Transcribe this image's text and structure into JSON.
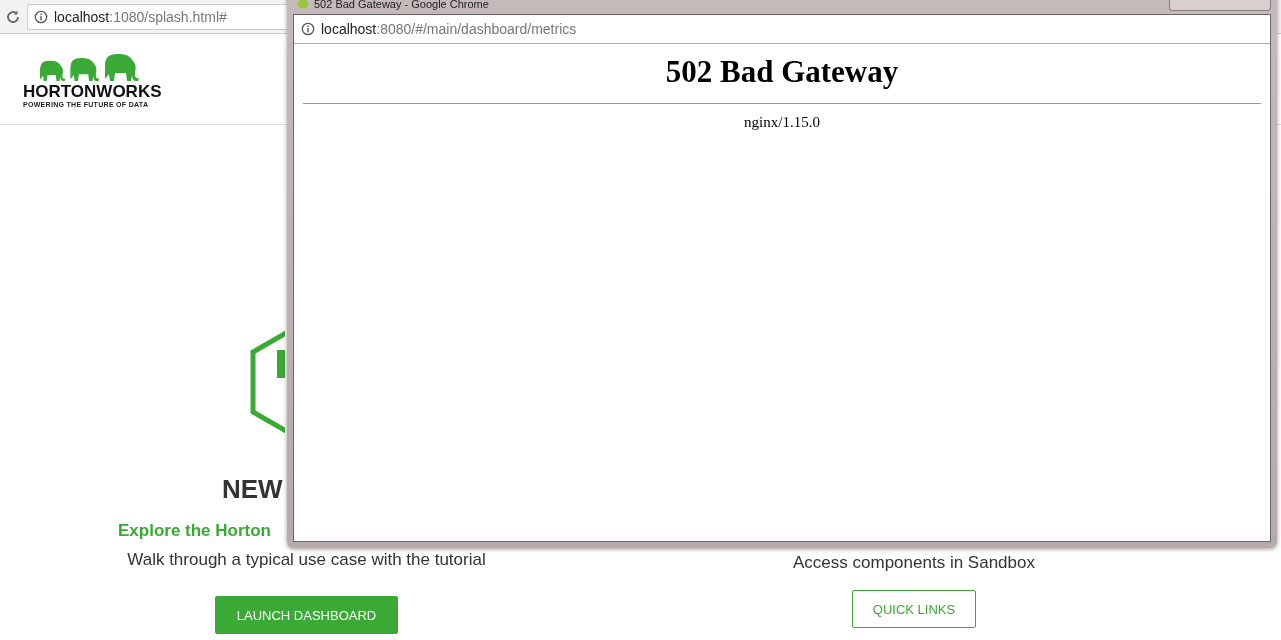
{
  "browser": {
    "url_host": "localhost",
    "url_rest": ":1080/splash.html#"
  },
  "header": {
    "logo_name": "HORTONWORKS",
    "logo_tagline": "POWERING THE FUTURE OF DATA"
  },
  "left_panel": {
    "heading": "NEW",
    "subheading": "Explore the Horton",
    "text": "Walk through a typical use case with the tutorial",
    "button": {
      "label": "LAUNCH DASHBOARD",
      "kind": "filled"
    }
  },
  "right_panel": {
    "text": "Access components in Sandbox",
    "button": {
      "label": "QUICK LINKS",
      "kind": "outline"
    }
  },
  "popup": {
    "title": "502 Bad Gateway - Google Chrome",
    "url_host": "localhost",
    "url_rest": ":8080/#/main/dashboard/metrics",
    "heading": "502 Bad Gateway",
    "server": "nginx/1.15.0"
  }
}
